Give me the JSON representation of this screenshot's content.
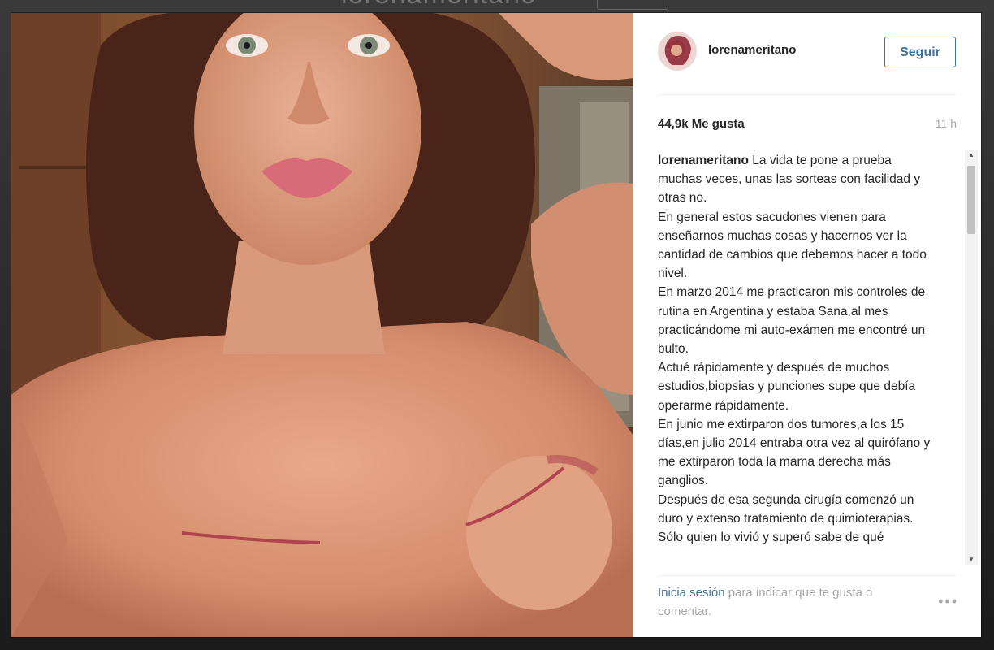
{
  "background": {
    "title": "lorenameritano"
  },
  "post": {
    "username": "lorenameritano",
    "follow_label": "Seguir",
    "likes": "44,9k Me gusta",
    "time": "11 h",
    "caption_user": "lorenameritano",
    "caption_lines": [
      " La vida te pone a prueba muchas veces, unas las sorteas con facilidad y otras no.",
      "En general estos sacudones vienen para enseñarnos muchas cosas y hacernos ver la cantidad de cambios que debemos hacer a todo nivel.",
      "En marzo 2014 me practicaron mis controles de rutina en Argentina y estaba Sana,al mes practicándome mi auto-exámen me encontré un bulto.",
      "Actué rápidamente y después de muchos estudios,biopsias y punciones supe que debía operarme rápidamente.",
      "En junio me extirparon dos tumores,a los 15 días,en julio 2014 entraba otra vez al quirófano y me extirparon toda la mama derecha más ganglios.",
      "Después de esa segunda cirugía comenzó un duro y extenso tratamiento de quimioterapias.",
      "Sólo quien lo vivió y superó sabe de qué"
    ]
  },
  "footer": {
    "login_label": "Inicia sesión",
    "rest_label": " para indicar que te gusta o comentar.",
    "more_label": "•••"
  },
  "colors": {
    "link": "#3f729b",
    "muted": "#a5a7aa",
    "text": "#262626"
  }
}
